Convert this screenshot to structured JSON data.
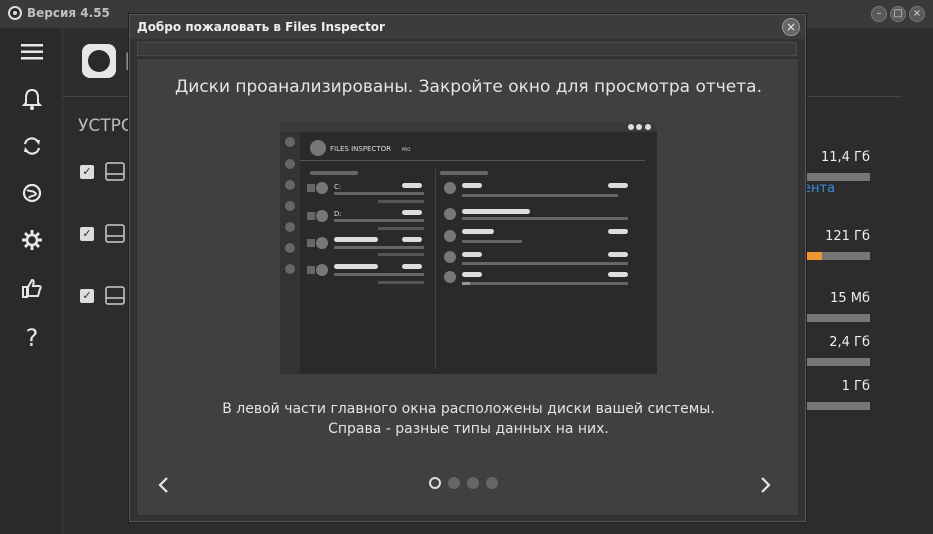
{
  "app": {
    "version": "Версия 4.55",
    "main_title_initial": "F",
    "section_title": "УСТРС"
  },
  "modal": {
    "title": "Добро пожаловать в Files Inspector",
    "headline": "Диски проанализированы. Закройте окно для просмотра отчета.",
    "desc_line1": "В левой части главного окна расположены диски вашей системы.",
    "desc_line2": "Справа - разные типы данных на них.",
    "pages_total": 4,
    "page_active": 1,
    "preview": {
      "app_name": "FILES INSPECTOR",
      "app_edition": "PRO",
      "drive_c": "C:",
      "drive_d": "D:"
    }
  },
  "right_panel": {
    "items": [
      {
        "size": "11,4 Гб",
        "fill": 0
      },
      {
        "size": "121 Гб",
        "fill": 0.3
      },
      {
        "size": "15 Мб",
        "fill": 0
      },
      {
        "size": "2,4 Гб",
        "fill": 0
      },
      {
        "size": "1 Гб",
        "fill": 0
      }
    ],
    "link_text": "ента"
  },
  "sidebar": {
    "icons": [
      "menu-icon",
      "bell-icon",
      "refresh-icon",
      "globe-icon",
      "gear-icon",
      "thumbs-up-icon",
      "help-icon"
    ]
  },
  "colors": {
    "accent": "#f0962a",
    "link": "#3a8ee0"
  }
}
